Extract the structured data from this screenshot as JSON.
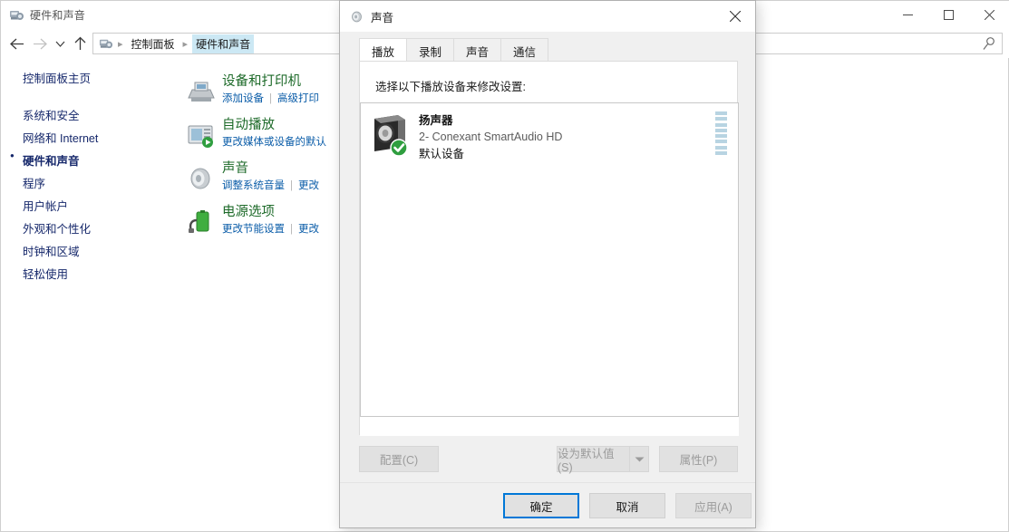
{
  "window": {
    "title": "硬件和声音",
    "title_icon": "hardware-sound-icon",
    "minimize_label": "—",
    "maximize_label": "□",
    "close_label": "✕"
  },
  "nav": {
    "back": "←",
    "forward": "→",
    "recent": "⌄",
    "up": "↑",
    "search_icon": "search-icon",
    "breadcrumb": [
      {
        "label": "控制面板",
        "active": false
      },
      {
        "label": "硬件和声音",
        "active": true
      }
    ]
  },
  "sidebar": {
    "home": "控制面板主页",
    "items": [
      {
        "label": "系统和安全",
        "current": false
      },
      {
        "label": "网络和 Internet",
        "current": false
      },
      {
        "label": "硬件和声音",
        "current": true
      },
      {
        "label": "程序",
        "current": false
      },
      {
        "label": "用户帐户",
        "current": false
      },
      {
        "label": "外观和个性化",
        "current": false
      },
      {
        "label": "时钟和区域",
        "current": false
      },
      {
        "label": "轻松使用",
        "current": false
      }
    ]
  },
  "categories": [
    {
      "title": "设备和打印机",
      "icon": "printer-icon",
      "links": [
        "添加设备",
        "高级打印"
      ]
    },
    {
      "title": "自动播放",
      "icon": "autoplay-icon",
      "links": [
        "更改媒体或设备的默认"
      ]
    },
    {
      "title": "声音",
      "icon": "speaker-icon",
      "links": [
        "调整系统音量",
        "更改"
      ]
    },
    {
      "title": "电源选项",
      "icon": "battery-icon",
      "links": [
        "更改节能设置",
        "更改"
      ]
    }
  ],
  "dialog": {
    "title": "声音",
    "title_icon": "speaker-small-icon",
    "close_label": "✕",
    "tabs": [
      {
        "label": "播放",
        "active": true
      },
      {
        "label": "录制",
        "active": false
      },
      {
        "label": "声音",
        "active": false
      },
      {
        "label": "通信",
        "active": false
      }
    ],
    "panel_label": "选择以下播放设备来修改设置:",
    "devices": [
      {
        "name": "扬声器",
        "subtitle": "2- Conexant SmartAudio HD",
        "status": "默认设备",
        "icon": "speaker-device-icon",
        "badge": "default-check-badge",
        "meter_segments": 8
      }
    ],
    "mid_buttons": [
      {
        "label": "配置(C)",
        "name": "configure-button",
        "disabled": true
      },
      {
        "label": "设为默认值(S)",
        "name": "set-default-button",
        "disabled": true
      },
      {
        "label": "属性(P)",
        "name": "properties-button",
        "disabled": true
      }
    ],
    "footer_buttons": [
      {
        "label": "确定",
        "name": "ok-button",
        "disabled": false,
        "focused": true
      },
      {
        "label": "取消",
        "name": "cancel-button",
        "disabled": false,
        "focused": false
      },
      {
        "label": "应用(A)",
        "name": "apply-button",
        "disabled": true,
        "focused": false
      }
    ]
  },
  "colors": {
    "accent": "#0078d7",
    "category_title": "#1d6a29",
    "link": "#0a5ca8",
    "sidebar_link": "#16286b",
    "meter": "#b8d4e2"
  }
}
